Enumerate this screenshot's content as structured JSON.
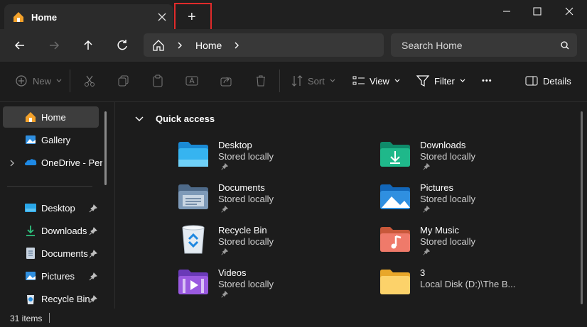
{
  "window": {
    "tab_title": "Home",
    "new_tab_symbol": "+",
    "minimize_icon": "minimize-icon",
    "maximize_icon": "maximize-icon",
    "close_icon": "close-icon"
  },
  "nav": {
    "breadcrumb_current": "Home",
    "search_placeholder": "Search Home"
  },
  "toolbar": {
    "new_label": "New",
    "sort_label": "Sort",
    "view_label": "View",
    "filter_label": "Filter",
    "more_label": "•••",
    "details_label": "Details"
  },
  "sidebar": {
    "items": [
      {
        "label": "Home",
        "icon": "home-icon"
      },
      {
        "label": "Gallery",
        "icon": "gallery-icon"
      },
      {
        "label": "OneDrive - Perso",
        "icon": "onedrive-icon"
      },
      {
        "label": "Desktop",
        "icon": "desktop-folder-icon"
      },
      {
        "label": "Downloads",
        "icon": "downloads-icon"
      },
      {
        "label": "Documents",
        "icon": "documents-icon"
      },
      {
        "label": "Pictures",
        "icon": "pictures-icon"
      },
      {
        "label": "Recycle Bin",
        "icon": "recycle-bin-icon"
      }
    ]
  },
  "main": {
    "section_title": "Quick access",
    "items": [
      {
        "name": "Desktop",
        "sub": "Stored locally"
      },
      {
        "name": "Downloads",
        "sub": "Stored locally"
      },
      {
        "name": "Documents",
        "sub": "Stored locally"
      },
      {
        "name": "Pictures",
        "sub": "Stored locally"
      },
      {
        "name": "Recycle Bin",
        "sub": "Stored locally"
      },
      {
        "name": "My Music",
        "sub": "Stored locally"
      },
      {
        "name": "Videos",
        "sub": "Stored locally"
      },
      {
        "name": "3",
        "sub": "Local Disk (D:)\\The B..."
      }
    ]
  },
  "status": {
    "item_count": "31 items"
  },
  "colors": {
    "accent": "#0078d4",
    "highlight_border": "#e02b2b"
  }
}
